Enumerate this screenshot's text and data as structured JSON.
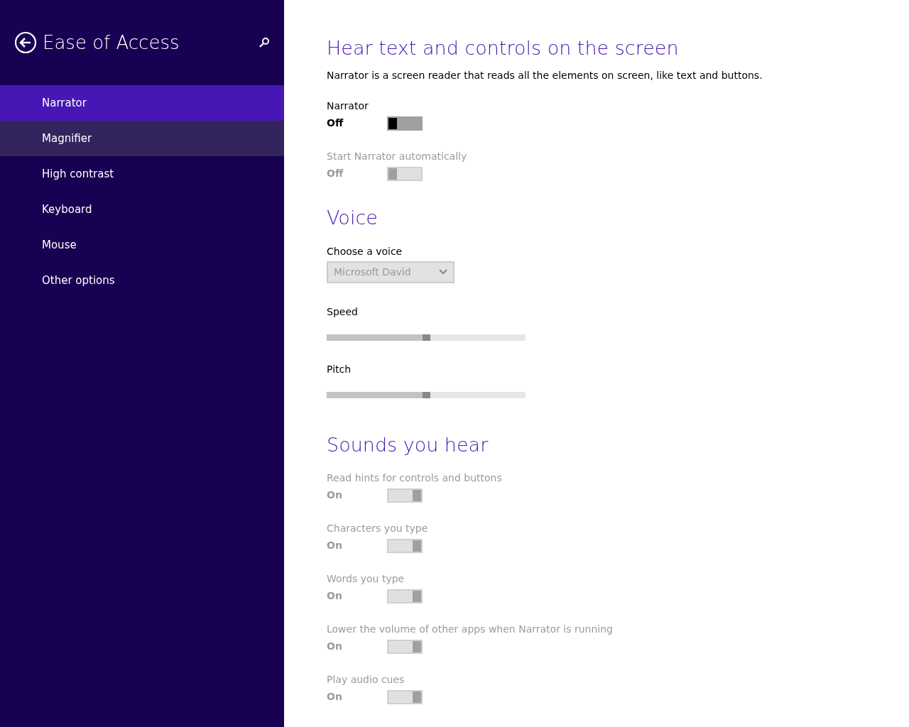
{
  "sidebar": {
    "title": "Ease of Access",
    "items": [
      {
        "label": "Narrator",
        "selected": true,
        "hovered": false
      },
      {
        "label": "Magnifier",
        "selected": false,
        "hovered": true
      },
      {
        "label": "High contrast",
        "selected": false,
        "hovered": false
      },
      {
        "label": "Keyboard",
        "selected": false,
        "hovered": false
      },
      {
        "label": "Mouse",
        "selected": false,
        "hovered": false
      },
      {
        "label": "Other options",
        "selected": false,
        "hovered": false
      }
    ]
  },
  "sections": [
    {
      "heading": "Hear text and controls on the screen",
      "description": "Narrator is a screen reader that reads all the elements on screen, like text and buttons.",
      "controls": [
        {
          "kind": "toggle",
          "label": "Narrator",
          "state": "Off",
          "on": false,
          "disabled": false
        },
        {
          "kind": "toggle",
          "label": "Start Narrator automatically",
          "state": "Off",
          "on": false,
          "disabled": true
        }
      ]
    },
    {
      "heading": "Voice",
      "controls": [
        {
          "kind": "dropdown",
          "label": "Choose a voice",
          "value": "Microsoft David",
          "disabled": true
        },
        {
          "kind": "slider",
          "label": "Speed",
          "level": 0.5,
          "disabled": true
        },
        {
          "kind": "slider",
          "label": "Pitch",
          "level": 0.5,
          "disabled": true
        }
      ]
    },
    {
      "heading": "Sounds you hear",
      "controls": [
        {
          "kind": "toggle",
          "label": "Read hints for controls and buttons",
          "state": "On",
          "on": true,
          "disabled": true
        },
        {
          "kind": "toggle",
          "label": "Characters you type",
          "state": "On",
          "on": true,
          "disabled": true
        },
        {
          "kind": "toggle",
          "label": "Words you type",
          "state": "On",
          "on": true,
          "disabled": true
        },
        {
          "kind": "toggle",
          "label": "Lower the volume of other apps when Narrator is running",
          "state": "On",
          "on": true,
          "disabled": true
        },
        {
          "kind": "toggle",
          "label": "Play audio cues",
          "state": "On",
          "on": true,
          "disabled": true
        }
      ]
    }
  ]
}
